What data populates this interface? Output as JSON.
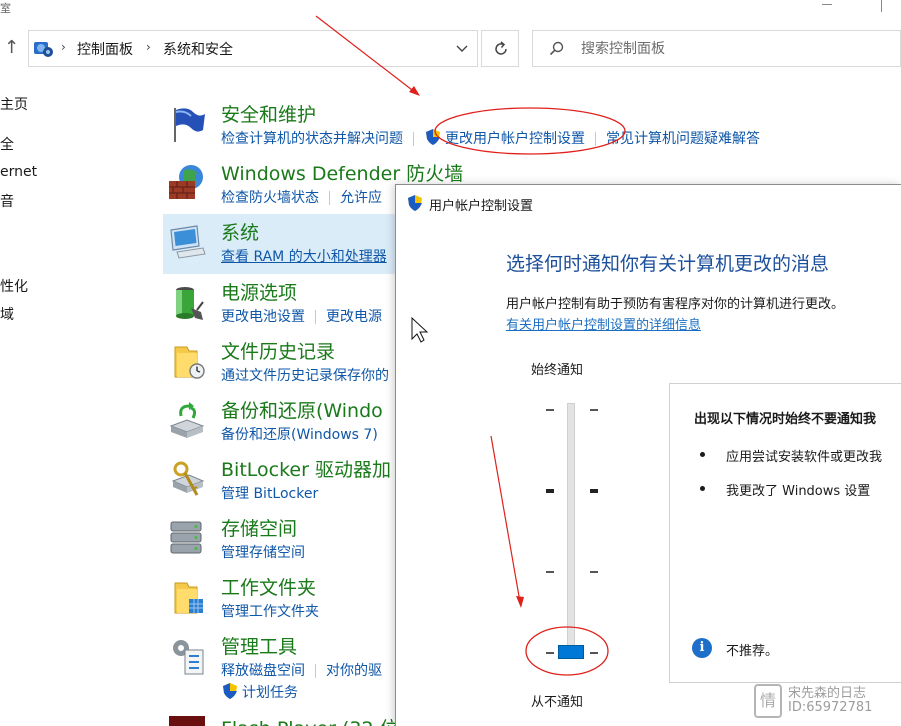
{
  "topbar": {
    "left_fragment": "室"
  },
  "address": {
    "crumbs": [
      "控制面板",
      "系统和安全"
    ],
    "separator": "›"
  },
  "search": {
    "placeholder": "搜索控制面板"
  },
  "leftnav": {
    "items": [
      "主页",
      "全",
      "ernet",
      "音",
      "性化",
      "域"
    ]
  },
  "categories": [
    {
      "title": "安全和维护",
      "links": [
        "检查计算机的状态并解决问题",
        "更改用户帐户控制设置",
        "常见计算机问题疑难解答"
      ]
    },
    {
      "title": "Windows Defender 防火墙",
      "links": [
        "检查防火墙状态",
        "允许应"
      ]
    },
    {
      "title": "系统",
      "links": [
        "查看 RAM 的大小和处理器"
      ]
    },
    {
      "title": "电源选项",
      "links": [
        "更改电池设置",
        "更改电源"
      ]
    },
    {
      "title": "文件历史记录",
      "links": [
        "通过文件历史记录保存你的"
      ]
    },
    {
      "title": "备份和还原(Windo",
      "links": [
        "备份和还原(Windows 7)"
      ]
    },
    {
      "title": "BitLocker 驱动器加",
      "links": [
        "管理 BitLocker"
      ]
    },
    {
      "title": "存储空间",
      "links": [
        "管理存储空间"
      ]
    },
    {
      "title": "工作文件夹",
      "links": [
        "管理工作文件夹"
      ]
    },
    {
      "title": "管理工具",
      "links": [
        "释放磁盘空间",
        "对你的驱"
      ],
      "links2": [
        "计划任务"
      ]
    },
    {
      "title": "Flash Player (32 位",
      "links": []
    }
  ],
  "dialog": {
    "title": "用户帐户控制设置",
    "heading": "选择何时通知你有关计算机更改的消息",
    "description": "用户帐户控制有助于预防有害程序对你的计算机进行更改。",
    "link": "有关用户帐户控制设置的详细信息",
    "slider_top_label": "始终通知",
    "slider_bottom_label": "从不通知",
    "slider_level": 0,
    "slider_levels_total": 4,
    "panel": {
      "heading": "出现以下情况时始终不要通知我",
      "bullets": [
        "应用尝试安装软件或更改我",
        "我更改了 Windows 设置"
      ],
      "note": "不推荐。"
    }
  },
  "watermark": {
    "line1": "宋先森的日志",
    "line2": "ID:65972781",
    "logo_glyph": "情"
  },
  "colors": {
    "category_title": "#1a7a1a",
    "link": "#0f57a8",
    "dialog_heading": "#1c4f9c",
    "slider_thumb": "#0078d7",
    "annotation": "#e0201b"
  }
}
